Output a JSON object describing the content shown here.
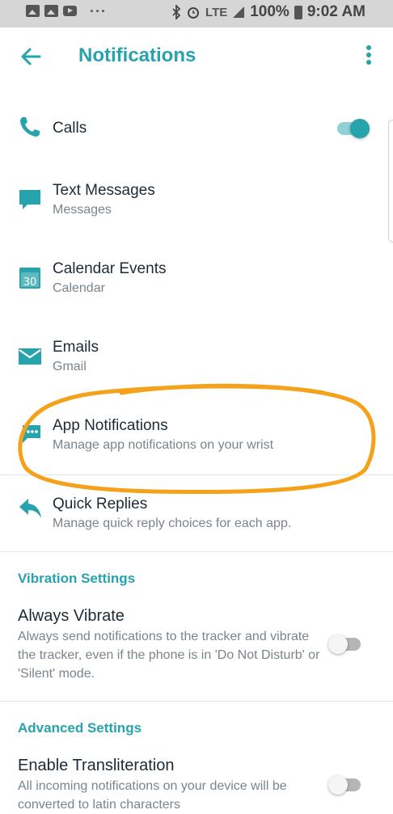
{
  "status_bar": {
    "dots": "···",
    "network": "LTE",
    "battery_percent": "100%",
    "time": "9:02 AM"
  },
  "header": {
    "title": "Notifications"
  },
  "items": [
    {
      "title": "Calls",
      "subtitle": "",
      "icon": "phone-icon",
      "toggle": true
    },
    {
      "title": "Text Messages",
      "subtitle": "Messages",
      "icon": "message-icon"
    },
    {
      "title": "Calendar Events",
      "subtitle": "Calendar",
      "icon": "calendar-icon",
      "icon_text": "30"
    },
    {
      "title": "Emails",
      "subtitle": "Gmail",
      "icon": "mail-icon"
    },
    {
      "title": "App Notifications",
      "subtitle": "Manage app notifications on your wrist",
      "icon": "app-chat-icon"
    },
    {
      "title": "Quick Replies",
      "subtitle": "Manage quick reply choices for each app.",
      "icon": "reply-icon"
    }
  ],
  "vibration": {
    "section_title": "Vibration Settings",
    "always_vibrate_title": "Always Vibrate",
    "always_vibrate_desc": "Always send notifications to the tracker and vibrate the tracker, even if the phone is in 'Do Not Disturb' or 'Silent' mode.",
    "always_vibrate_on": false
  },
  "advanced": {
    "section_title": "Advanced Settings",
    "transliteration_title": "Enable Transliteration",
    "transliteration_desc": "All incoming notifications on your device will be converted to latin characters",
    "transliteration_on": false
  },
  "colors": {
    "accent": "#27a3ad",
    "highlight": "#f5a21b"
  }
}
